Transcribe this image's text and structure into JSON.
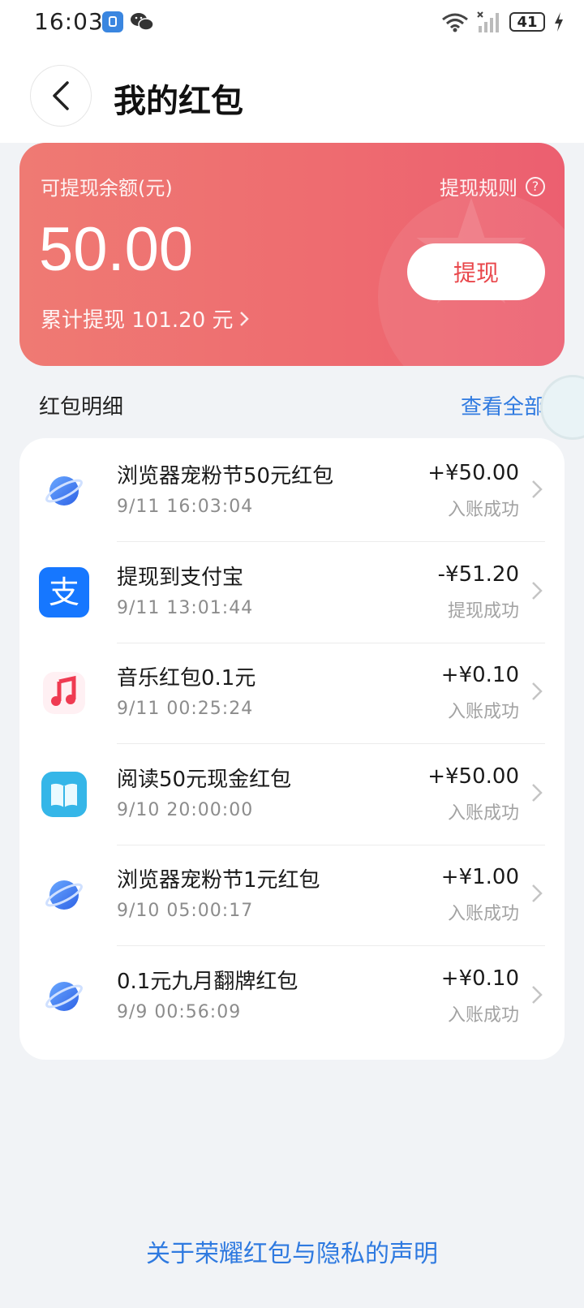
{
  "status_bar": {
    "time": "16:03",
    "battery": "41"
  },
  "header": {
    "title": "我的红包"
  },
  "balance": {
    "label": "可提现余额(元)",
    "rules_label": "提现规则",
    "amount": "50.00",
    "total_text": "累计提现 101.20 元",
    "withdraw_label": "提现",
    "accent": "#ee6c70"
  },
  "section": {
    "title": "红包明细",
    "view_all": "查看全部"
  },
  "transactions": [
    {
      "icon": "browser-planet-icon",
      "title": "浏览器宠粉节50元红包",
      "time": "9/11 16:03:04",
      "amount": "+¥50.00",
      "status": "入账成功"
    },
    {
      "icon": "alipay-icon",
      "title": "提现到支付宝",
      "time": "9/11 13:01:44",
      "amount": "-¥51.20",
      "status": "提现成功"
    },
    {
      "icon": "music-icon",
      "title": "音乐红包0.1元",
      "time": "9/11 00:25:24",
      "amount": "+¥0.10",
      "status": "入账成功"
    },
    {
      "icon": "book-icon",
      "title": "阅读50元现金红包",
      "time": "9/10 20:00:00",
      "amount": "+¥50.00",
      "status": "入账成功"
    },
    {
      "icon": "browser-planet-icon",
      "title": "浏览器宠粉节1元红包",
      "time": "9/10 05:00:17",
      "amount": "+¥1.00",
      "status": "入账成功"
    },
    {
      "icon": "browser-planet-icon",
      "title": "0.1元九月翻牌红包",
      "time": "9/9 00:56:09",
      "amount": "+¥0.10",
      "status": "入账成功"
    }
  ],
  "footer": {
    "link": "关于荣耀红包与隐私的声明"
  },
  "colors": {
    "link": "#2f7ae0",
    "withdraw_text": "#e9474b"
  }
}
